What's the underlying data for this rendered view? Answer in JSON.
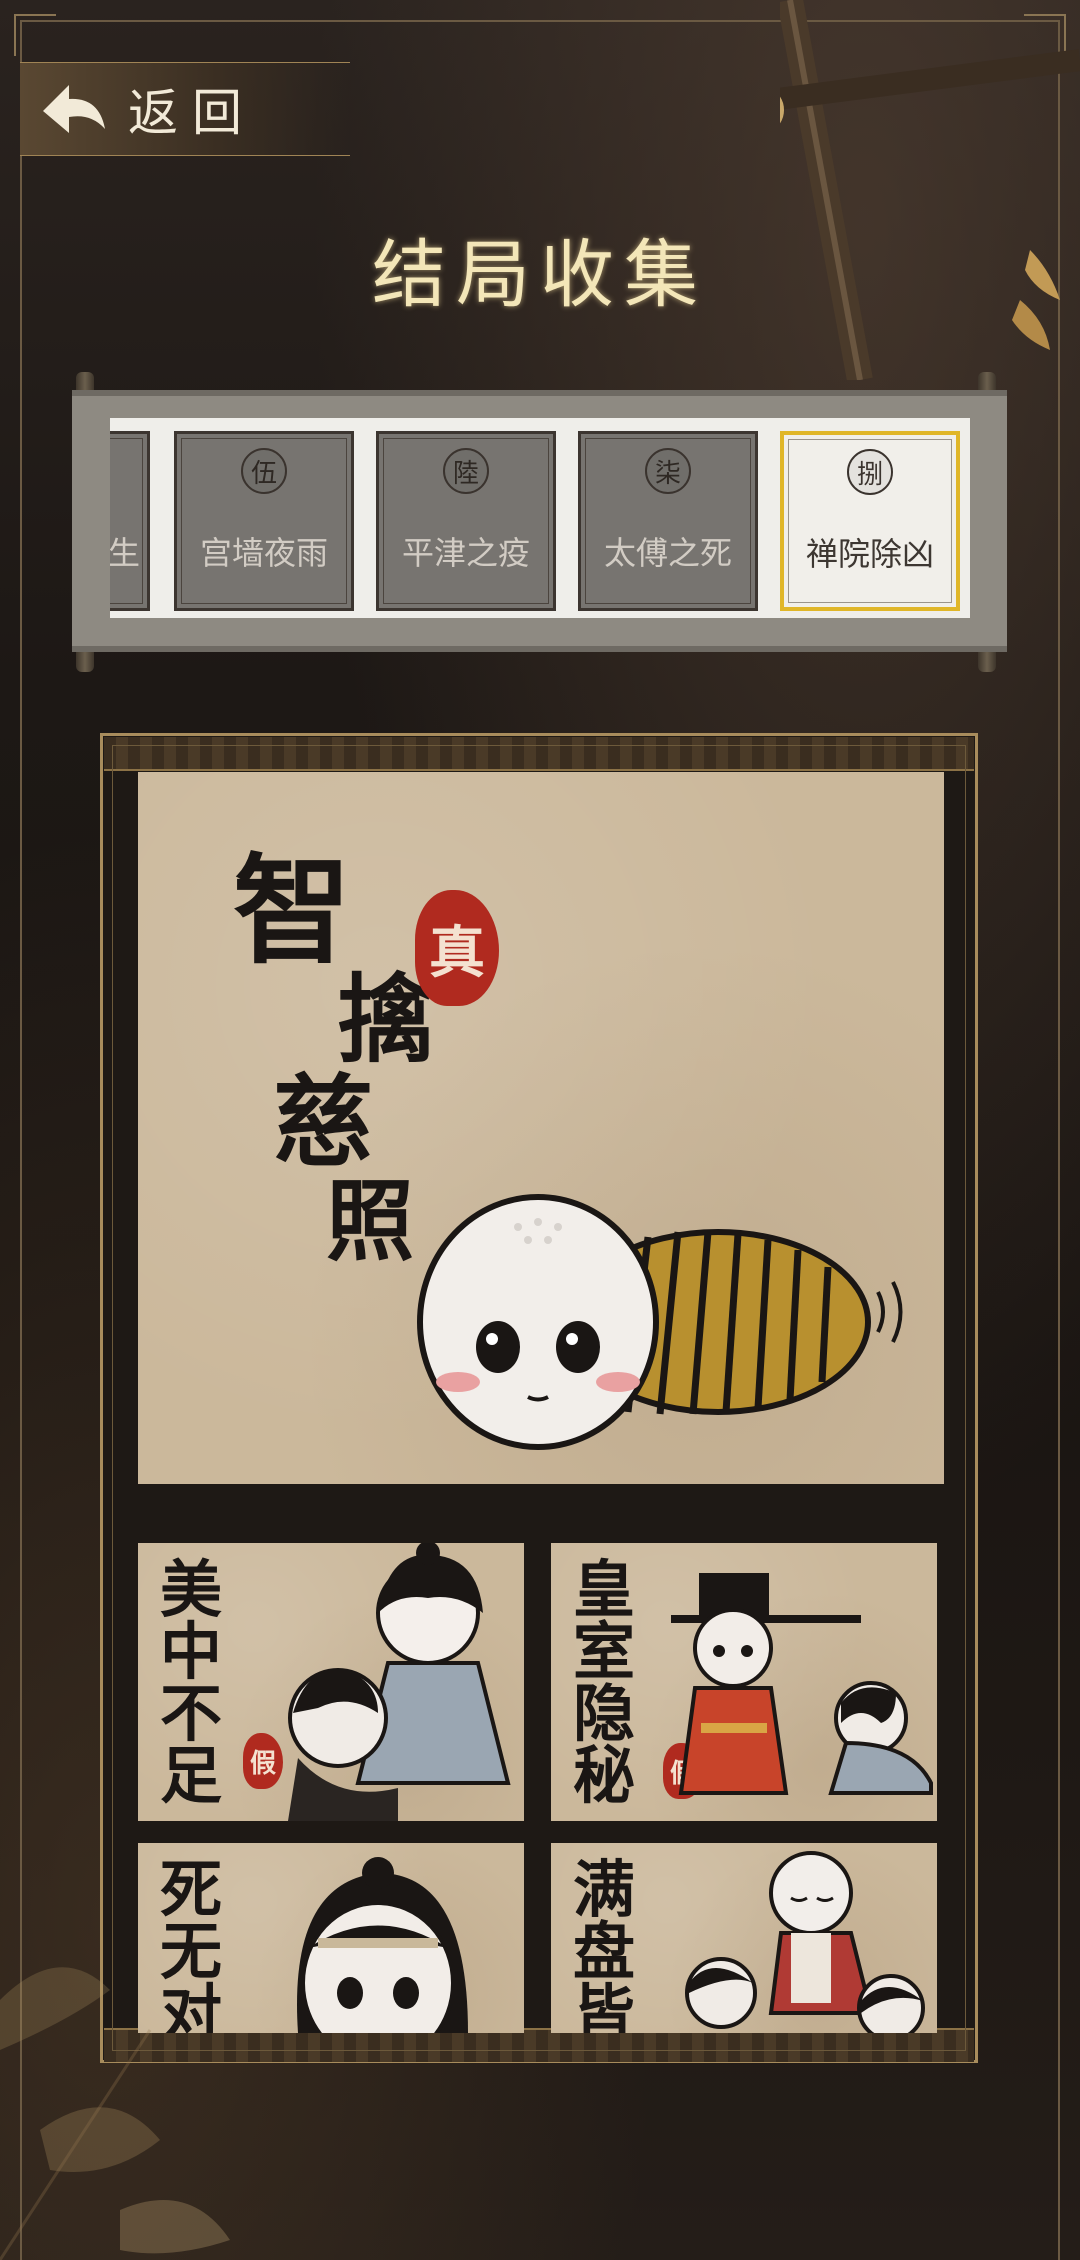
{
  "header": {
    "back_label": "返回",
    "title": "结局收集"
  },
  "chapters": [
    {
      "num": "",
      "name": "生",
      "state": "locked"
    },
    {
      "num": "伍",
      "name": "宫墙夜雨",
      "state": "locked"
    },
    {
      "num": "陸",
      "name": "平津之疫",
      "state": "locked"
    },
    {
      "num": "柒",
      "name": "太傅之死",
      "state": "locked"
    },
    {
      "num": "捌",
      "name": "禅院除凶",
      "state": "selected"
    }
  ],
  "main_ending": {
    "title": "智擒慈照",
    "seal": "真",
    "icon": "monk-rolled-in-mat-illustration"
  },
  "endings": [
    {
      "title": "美中不足",
      "seal": "假",
      "icon": "kneeling-couple-illustration"
    },
    {
      "title": "皇室隐秘",
      "seal": "假",
      "icon": "official-and-kneeling-woman-illustration"
    },
    {
      "title": "死无对",
      "seal": "",
      "icon": "crying-woman-illustration"
    },
    {
      "title": "满盘皆",
      "seal": "",
      "icon": "monk-and-bowing-figures-illustration"
    }
  ],
  "colors": {
    "accent_gold": "#e0b628",
    "seal_red": "#b02a1f",
    "paper": "#cbb89b",
    "title": "#f3e6b8"
  }
}
